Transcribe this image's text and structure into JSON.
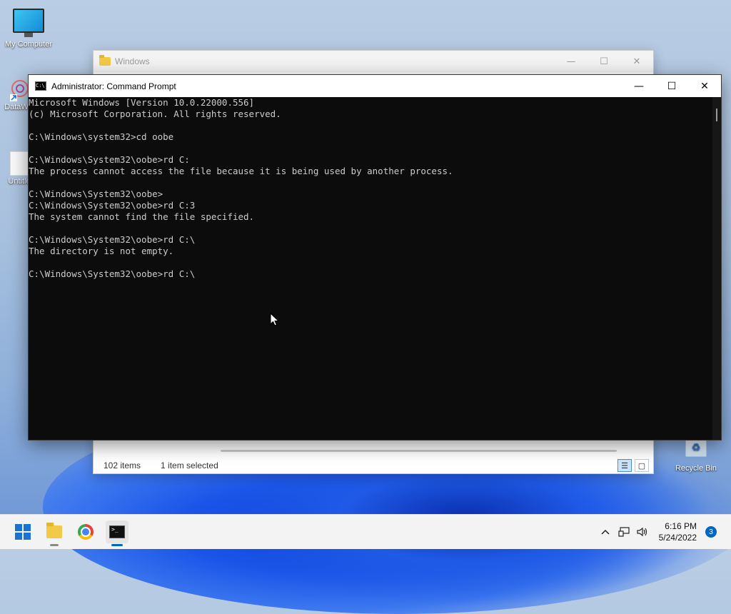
{
  "desktop": {
    "icons": [
      {
        "label": "My Computer",
        "icon": "monitor-icon"
      },
      {
        "label": "DataW",
        "icon": "app-shortcut-icon"
      },
      {
        "label": "Untitle",
        "icon": "document-icon"
      },
      {
        "label": "Recycle Bin",
        "icon": "recycle-bin-icon"
      }
    ]
  },
  "explorer": {
    "title": "Windows",
    "status_count": "102 items",
    "status_selected": "1 item selected"
  },
  "cmd": {
    "title": "Administrator: Command Prompt",
    "lines": [
      "Microsoft Windows [Version 10.0.22000.556]",
      "(c) Microsoft Corporation. All rights reserved.",
      "",
      "C:\\Windows\\system32>cd oobe",
      "",
      "C:\\Windows\\System32\\oobe>rd C:",
      "The process cannot access the file because it is being used by another process.",
      "",
      "C:\\Windows\\System32\\oobe>",
      "C:\\Windows\\System32\\oobe>rd C:3",
      "The system cannot find the file specified.",
      "",
      "C:\\Windows\\System32\\oobe>rd C:\\",
      "The directory is not empty.",
      "",
      "C:\\Windows\\System32\\oobe>rd C:\\"
    ]
  },
  "taskbar": {
    "clock_time": "6:16 PM",
    "clock_date": "5/24/2022",
    "notification_count": "3"
  }
}
